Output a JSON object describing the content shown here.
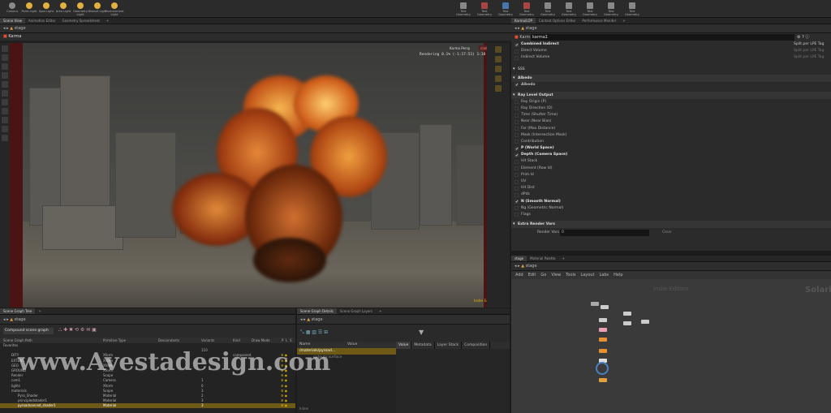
{
  "shelf_tools": [
    {
      "label": "Camera",
      "color": "#8b8b8b"
    },
    {
      "label": "Point Light",
      "color": "#e0b040"
    },
    {
      "label": "Spot Light",
      "color": "#e0b040"
    },
    {
      "label": "Area Light",
      "color": "#e0b040"
    },
    {
      "label": "Geometry Light",
      "color": "#e0b040"
    },
    {
      "label": "Distant Light",
      "color": "#e0b040"
    },
    {
      "label": "Environment Light",
      "color": "#e0b040"
    }
  ],
  "shelf_tools_right": [
    {
      "label": "Test Geometry",
      "color": "#888"
    },
    {
      "label": "Test Geometry",
      "color": "#aa4444"
    },
    {
      "label": "Test Geometry",
      "color": "#4477aa"
    },
    {
      "label": "Test Geometry",
      "color": "#aa4444"
    },
    {
      "label": "Test Geometry",
      "color": "#888"
    },
    {
      "label": "Test Geometry",
      "color": "#888"
    },
    {
      "label": "Test Geometry",
      "color": "#888"
    },
    {
      "label": "Test Geometry",
      "color": "#888"
    },
    {
      "label": "Test Geometry",
      "color": "#888"
    }
  ],
  "left_tabs": [
    "Scene View",
    "Animation Editor",
    "Geometry Spreadsheet",
    "+"
  ],
  "right_tabs": [
    "Karma/LOP",
    "Context Options Editor",
    "Performance Monitor",
    "+"
  ],
  "viewport": {
    "path": "stage",
    "panel_title": "Karma",
    "renderer": "Karma Persp",
    "camera": "/cam1",
    "rendering_status": "Rendering  0.1%  (-1:17:53)  1:38",
    "indie_label": "Indie Edition"
  },
  "params_panel": {
    "path": "stage",
    "node_type": "Karma",
    "node_name": "karma1",
    "rows_top": [
      {
        "label": "Combined Indirect",
        "checked": true,
        "bold": true,
        "right": "Split per LPE Tag"
      },
      {
        "label": "Direct Volume",
        "checked": false,
        "bold": false,
        "right": "Split per LPE Tag"
      },
      {
        "label": "Indirect Volume",
        "checked": false,
        "bold": false,
        "right": "Split per LPE Tag"
      }
    ],
    "collapsed_sss": "SSS",
    "albedo_section": "Albedo",
    "albedo_row": {
      "label": "Albedo",
      "checked": true
    },
    "ray_section": "Ray Level Output",
    "ray_rows": [
      {
        "label": "Ray Origin (P)",
        "checked": false,
        "bold": false
      },
      {
        "label": "Ray Direction (D)",
        "checked": false,
        "bold": false
      },
      {
        "label": "Time (Shutter Time)",
        "checked": false,
        "bold": false
      },
      {
        "label": "Near (Near Bias)",
        "checked": false,
        "bold": false
      },
      {
        "label": "Far (Max Distance)",
        "checked": false,
        "bold": false
      },
      {
        "label": "Mask (Intersection Mask)",
        "checked": false,
        "bold": false
      },
      {
        "label": "Contribution",
        "checked": false,
        "bold": false
      },
      {
        "label": "P (World Space)",
        "checked": true,
        "bold": true
      },
      {
        "label": "Depth (Camera Space)",
        "checked": true,
        "bold": true
      },
      {
        "label": "Hit Stack",
        "checked": false,
        "bold": false
      },
      {
        "label": "Element (Row Id)",
        "checked": false,
        "bold": false
      },
      {
        "label": "Prim Id",
        "checked": false,
        "bold": false
      },
      {
        "label": "UV",
        "checked": false,
        "bold": false
      },
      {
        "label": "Hit Dist",
        "checked": false,
        "bold": false
      },
      {
        "label": "dPdz",
        "checked": false,
        "bold": false
      },
      {
        "label": "N (Smooth Normal)",
        "checked": true,
        "bold": true
      },
      {
        "label": "Ng (Geometric Normal)",
        "checked": false,
        "bold": false
      },
      {
        "label": "Flags",
        "checked": false,
        "bold": false
      }
    ],
    "extra_section": "Extra Render Vars",
    "render_vars_label": "Render Vars",
    "render_vars_value": "0",
    "clear_label": "Clear"
  },
  "network": {
    "tabs": [
      "stage",
      "Material Palette",
      "+"
    ],
    "path": "stage",
    "menu": [
      "Add",
      "Edit",
      "Go",
      "View",
      "Tools",
      "Layout",
      "Labs",
      "Help"
    ],
    "indie_label": "Indie Edition",
    "context_label": "Solaris"
  },
  "scene_tree": {
    "tabs": [
      "Scene Graph Tree",
      "+"
    ],
    "path": "stage",
    "filter": "Compound scene graph",
    "columns": [
      "Scene Graph Path",
      "Primitive Type",
      "Descendants",
      "Variants",
      "Kind",
      "Draw Mode",
      "P",
      "L",
      "S"
    ],
    "rows": [
      {
        "path": "Favorites",
        "type": "",
        "desc": "",
        "var": "",
        "kind": "",
        "hl": false
      },
      {
        "path": "",
        "type": "",
        "desc": "",
        "var": "110",
        "kind": "",
        "hl": false
      },
      {
        "path": "DITY",
        "type": "Xform",
        "desc": "",
        "var": "",
        "kind": "component",
        "hl": false
      },
      {
        "path": "EXTENT",
        "type": "Xform",
        "desc": "",
        "var": "",
        "kind": "",
        "hl": false
      },
      {
        "path": "GEO",
        "type": "Xform",
        "desc": "",
        "var": "",
        "kind": "",
        "hl": false
      },
      {
        "path": "GROUND",
        "type": "Xform",
        "desc": "",
        "var": "",
        "kind": "",
        "hl": false
      },
      {
        "path": "Render",
        "type": "Scope",
        "desc": "",
        "var": "",
        "kind": "",
        "hl": false
      },
      {
        "path": "cam1",
        "type": "Camera",
        "desc": "",
        "var": "1",
        "kind": "",
        "hl": false
      },
      {
        "path": "lights",
        "type": "Xform",
        "desc": "",
        "var": "0",
        "kind": "",
        "hl": false
      },
      {
        "path": "materials",
        "type": "Scope",
        "desc": "",
        "var": "3",
        "kind": "",
        "hl": false
      },
      {
        "path": "Pyro_Shader",
        "type": "Material",
        "desc": "",
        "var": "2",
        "kind": "",
        "hl": false
      },
      {
        "path": "principledshader1",
        "type": "Material",
        "desc": "",
        "var": "3",
        "kind": "",
        "hl": false
      },
      {
        "path": "pyroadvanced_shader1",
        "type": "Material",
        "desc": "",
        "var": "3",
        "kind": "",
        "hl": true
      }
    ]
  },
  "scene_details": {
    "tabs": [
      "Scene Graph Details",
      "Scene Graph Layers",
      "+"
    ],
    "path": "stage",
    "col_name": "Name",
    "col_value": "Value",
    "row_name": "/materials/pyroad...",
    "row_value": "",
    "row2": "outputs:surface",
    "subtabs": [
      "Value",
      "Metadata",
      "Layer Stack",
      "Composition"
    ],
    "footer": "Inline"
  },
  "watermark": "www.Avestadesign.com",
  "colors": {
    "accent": "#e6b800",
    "highlight": "#6e5a16"
  }
}
